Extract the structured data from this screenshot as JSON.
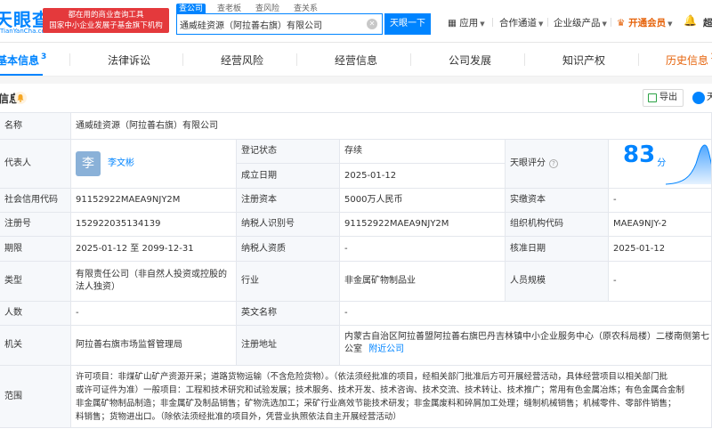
{
  "header": {
    "logo_text": "天眼查",
    "logo_url": "TianYanCha.com",
    "slogan_line1": "都在用的商业查询工具",
    "slogan_line2": "国家中小企业发展子基金旗下机构",
    "search_tabs": [
      "查公司",
      "查老板",
      "查风险",
      "查关系"
    ],
    "search_value": "通威硅资源（阿拉善右旗）有限公司",
    "search_button": "天眼一下",
    "nav": {
      "apps": "应用",
      "cooperation": "合作通道",
      "enterprise": "企业级产品",
      "vip": "开通会员",
      "user": "超"
    }
  },
  "tabs": {
    "items": [
      "基本信息",
      "法律诉讼",
      "经营风险",
      "经营信息",
      "公司发展",
      "知识产权",
      "历史信息"
    ],
    "basic_count": "3",
    "history_count": "1"
  },
  "section": {
    "title": "信息",
    "export": "导出",
    "tianyan": "天"
  },
  "info": {
    "company_name_label": "名称",
    "company_name": "通威硅资源（阿拉善右旗）有限公司",
    "legal_rep_label": "代表人",
    "legal_rep_avatar": "李",
    "legal_rep": "李文彬",
    "reg_status_label": "登记状态",
    "reg_status": "存续",
    "found_date_label": "成立日期",
    "found_date": "2025-01-12",
    "score_label": "天眼评分",
    "score": "83",
    "score_unit": "分",
    "credit_code_label": "社会信用代码",
    "credit_code": "91152922MAEA9NJY2M",
    "reg_capital_label": "注册资本",
    "reg_capital": "5000万人民币",
    "paid_capital_label": "实缴资本",
    "paid_capital": "-",
    "reg_no_label": "注册号",
    "reg_no": "152922035134139",
    "taxpayer_id_label": "纳税人识别号",
    "taxpayer_id": "91152922MAEA9NJY2M",
    "org_code_label": "组织机构代码",
    "org_code": "MAEA9NJY-2",
    "term_label": "期限",
    "term": "2025-01-12 至 2099-12-31",
    "taxpayer_qual_label": "纳税人资质",
    "taxpayer_qual": "-",
    "approve_date_label": "核准日期",
    "approve_date": "2025-01-12",
    "type_label": "类型",
    "type": "有限责任公司（非自然人投资或控股的法人独资）",
    "industry_label": "行业",
    "industry": "非金属矿物制品业",
    "staff_label": "人员规模",
    "staff": "-",
    "insured_label": "人数",
    "insured": "-",
    "english_name_label": "英文名称",
    "english_name": "-",
    "authority_label": "机关",
    "authority": "阿拉善右旗市场监督管理局",
    "address_label": "注册地址",
    "address_line1": "内蒙古自治区阿拉善盟阿拉善右旗巴丹吉林镇中小企业服务中心（原农科局楼）二楼南侧第七",
    "address_line2": "公室",
    "address_link": "附近公司",
    "scope_label": "范围",
    "scope_line1": "许可项目：非煤矿山矿产资源开采；道路货物运输（不含危险货物）。（依法须经批准的项目，经相关部门批准后方可开展经营活动，具体经营项目以相关部门批",
    "scope_line2": "或许可证件为准）一般项目：工程和技术研究和试验发展；技术服务、技术开发、技术咨询、技术交流、技术转让、技术推广；常用有色金属冶炼；有色金属合金制",
    "scope_line3": "非金属矿物制品制造；非金属矿及制品销售；矿物洗选加工；采矿行业高效节能技术研发；非金属废料和碎屑加工处理；缝制机械销售；机械零件、零部件销售；",
    "scope_line4": "料销售；货物进出口。（除依法须经批准的项目外，凭营业执照依法自主开展经营活动）"
  }
}
